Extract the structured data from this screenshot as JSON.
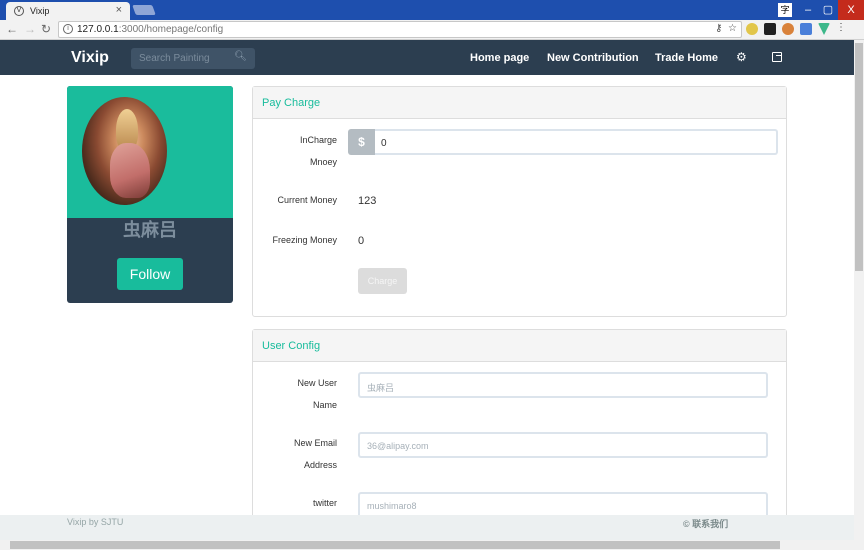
{
  "browser": {
    "tab_favicon": "V",
    "tab_title": "Vixip",
    "tab_close": "×",
    "url_host": "127.0.0.1",
    "url_path": ":3000/homepage/config",
    "ime_indicator": "字",
    "win_minimize": "–",
    "win_restore": "▢",
    "win_close": "X"
  },
  "navbar": {
    "brand": "Vixip",
    "search_placeholder": "Search Painting",
    "links": [
      "Home page",
      "New Contribution",
      "Trade Home"
    ]
  },
  "profile": {
    "username": "虫麻吕",
    "follow_label": "Follow"
  },
  "pay_charge": {
    "title": "Pay Charge",
    "incharge_label_1": "InCharge",
    "incharge_label_2": "Mnoey",
    "currency_symbol": "$",
    "incharge_value": "0",
    "current_money_label": "Current Money",
    "current_money_value": "123",
    "freezing_money_label": "Freezing Money",
    "freezing_money_value": "0",
    "charge_label": "Charge"
  },
  "user_config": {
    "title": "User Config",
    "new_user_label_1": "New User",
    "new_user_label_2": "Name",
    "new_user_placeholder": "虫麻吕",
    "new_email_label_1": "New Email",
    "new_email_label_2": "Address",
    "new_email_placeholder": "36@alipay.com",
    "twitter_label": "twitter",
    "twitter_placeholder": "mushimaro8"
  },
  "footer": {
    "left": "Vixip by SJTU",
    "right": "© 联系我们"
  },
  "colors": {
    "navbar": "#2c3e50",
    "accent": "#18bc9c",
    "chrome_titlebar": "#1e4fae"
  }
}
